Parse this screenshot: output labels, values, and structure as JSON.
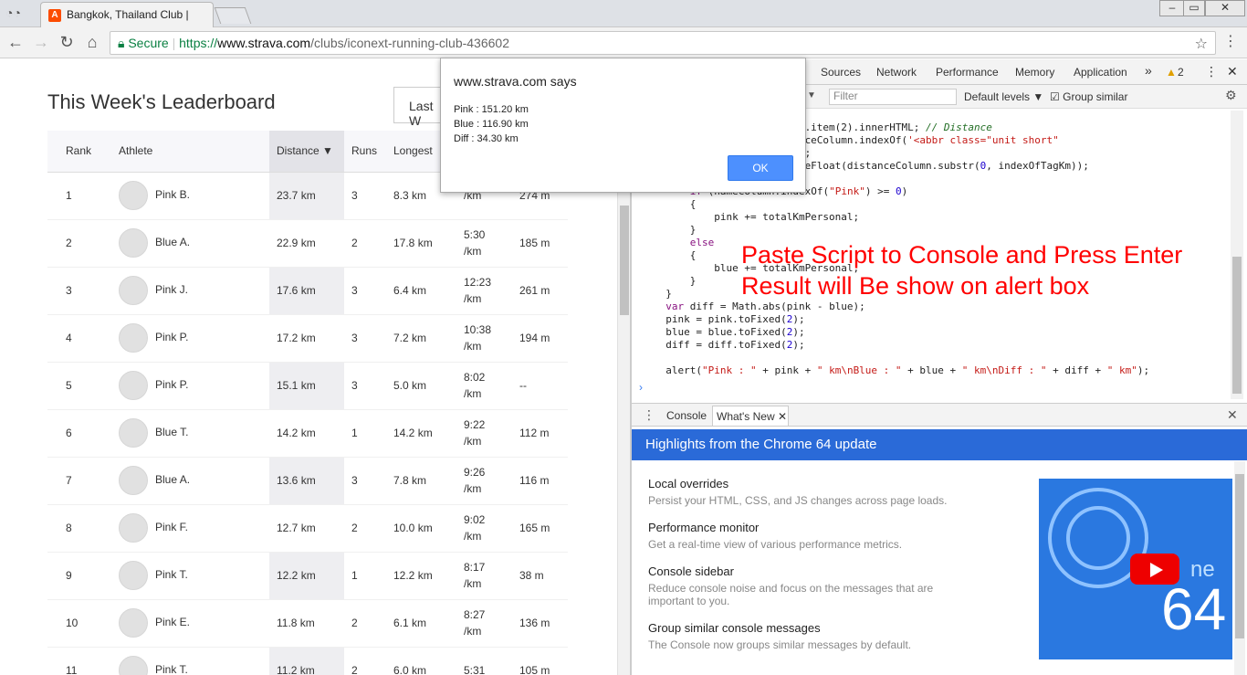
{
  "browser": {
    "tab_title": "Bangkok, Thailand Club |",
    "favicon_letter": "A",
    "secure_label": "Secure",
    "url_scheme": "https://",
    "url_host": "www.strava.com",
    "url_path": "/clubs/iconext-running-club-436602"
  },
  "page": {
    "leaderboard_title": "This Week's Leaderboard",
    "period_select": "Last W",
    "columns": [
      "Rank",
      "Athlete",
      "Distance ▼",
      "Runs",
      "Longest"
    ],
    "rows": [
      {
        "rank": "1",
        "athlete": "Pink B.",
        "distance": "23.7 km",
        "runs": "3",
        "longest": "8.3 km",
        "pace1": "",
        "pace2": "/km",
        "elev": "274 m"
      },
      {
        "rank": "2",
        "athlete": "Blue A.",
        "distance": "22.9 km",
        "runs": "2",
        "longest": "17.8 km",
        "pace1": "5:30",
        "pace2": "/km",
        "elev": "185 m"
      },
      {
        "rank": "3",
        "athlete": "Pink J.",
        "distance": "17.6 km",
        "runs": "3",
        "longest": "6.4 km",
        "pace1": "12:23",
        "pace2": "/km",
        "elev": "261 m"
      },
      {
        "rank": "4",
        "athlete": "Pink P.",
        "distance": "17.2 km",
        "runs": "3",
        "longest": "7.2 km",
        "pace1": "10:38",
        "pace2": "/km",
        "elev": "194 m"
      },
      {
        "rank": "5",
        "athlete": "Pink P.",
        "distance": "15.1 km",
        "runs": "3",
        "longest": "5.0 km",
        "pace1": "8:02",
        "pace2": "/km",
        "elev": "--"
      },
      {
        "rank": "6",
        "athlete": "Blue T.",
        "distance": "14.2 km",
        "runs": "1",
        "longest": "14.2 km",
        "pace1": "9:22",
        "pace2": "/km",
        "elev": "112 m"
      },
      {
        "rank": "7",
        "athlete": "Blue A.",
        "distance": "13.6 km",
        "runs": "3",
        "longest": "7.8 km",
        "pace1": "9:26",
        "pace2": "/km",
        "elev": "116 m"
      },
      {
        "rank": "8",
        "athlete": "Pink F.",
        "distance": "12.7 km",
        "runs": "2",
        "longest": "10.0 km",
        "pace1": "9:02",
        "pace2": "/km",
        "elev": "165 m"
      },
      {
        "rank": "9",
        "athlete": "Pink T.",
        "distance": "12.2 km",
        "runs": "1",
        "longest": "12.2 km",
        "pace1": "8:17",
        "pace2": "/km",
        "elev": "38 m"
      },
      {
        "rank": "10",
        "athlete": "Pink E.",
        "distance": "11.8 km",
        "runs": "2",
        "longest": "6.1 km",
        "pace1": "8:27",
        "pace2": "/km",
        "elev": "136 m"
      },
      {
        "rank": "11",
        "athlete": "Pink T.",
        "distance": "11.2 km",
        "runs": "2",
        "longest": "6.0 km",
        "pace1": "5:31",
        "pace2": "",
        "elev": "105 m"
      }
    ]
  },
  "alert": {
    "title": "www.strava.com says",
    "line1": "Pink : 151.20 km",
    "line2": "Blue : 116.90 km",
    "line3": "Diff : 34.30 km",
    "ok_label": "OK"
  },
  "devtools": {
    "tabs": [
      "Sources",
      "Network",
      "Performance",
      "Memory",
      "Application"
    ],
    "more": "»",
    "warn_count": "2",
    "filter_placeholder": "Filter",
    "levels_label": "Default levels ▼",
    "group_label": "Group similar",
    "overlay_line1": "Paste Script to Console and Press Enter",
    "overlay_line2": "Result will Be show on alert box",
    "drawer_tab_console": "Console",
    "drawer_tab_whatsnew": "What's New",
    "highlights_title": "Highlights from the Chrome 64 update",
    "features": [
      {
        "title": "Local overrides",
        "desc": "Persist your HTML, CSS, and JS changes across page loads."
      },
      {
        "title": "Performance monitor",
        "desc": "Get a real-time view of various performance metrics."
      },
      {
        "title": "Console sidebar",
        "desc": "Reduce console noise and focus on the messages that are important to you."
      },
      {
        "title": "Group similar console messages",
        "desc": "The Console now groups similar messages by default."
      }
    ],
    "video_num": "64",
    "video_ne": "ne"
  }
}
